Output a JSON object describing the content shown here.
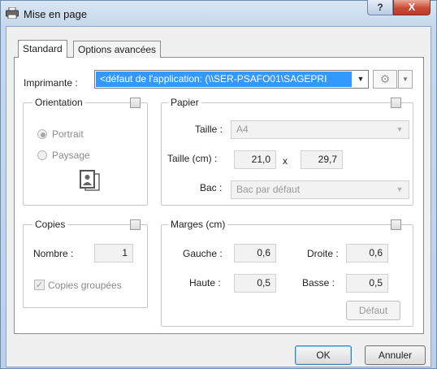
{
  "window": {
    "title": "Mise en page",
    "help_label": "?",
    "close_label": "X"
  },
  "tabs": [
    {
      "label": "Standard",
      "selected": true
    },
    {
      "label": "Options avancées",
      "selected": false
    }
  ],
  "printer": {
    "label": "Imprimante :",
    "value": "<défaut de l'application: (\\\\SER-PSAFO01\\SAGEPRI",
    "icon": "gear-icon"
  },
  "orientation": {
    "legend": "Orientation",
    "portrait_label": "Portrait",
    "portrait_selected": true,
    "landscape_label": "Paysage",
    "icon": "page-orientation-icon"
  },
  "paper": {
    "legend": "Papier",
    "size_label": "Taille :",
    "size_value": "A4",
    "size_cm_label": "Taille (cm) :",
    "width_value": "21,0",
    "times": "x",
    "height_value": "29,7",
    "tray_label": "Bac :",
    "tray_value": "Bac par défaut"
  },
  "copies": {
    "legend": "Copies",
    "number_label": "Nombre :",
    "number_value": "1",
    "collate_label": "Copies groupées",
    "collate_checked": true
  },
  "margins": {
    "legend": "Marges (cm)",
    "left_label": "Gauche :",
    "left_value": "0,6",
    "right_label": "Droite :",
    "right_value": "0,6",
    "top_label": "Haute :",
    "top_value": "0,5",
    "bottom_label": "Basse :",
    "bottom_value": "0,5",
    "default_button": "Défaut"
  },
  "footer": {
    "ok_label": "OK",
    "cancel_label": "Annuler"
  }
}
